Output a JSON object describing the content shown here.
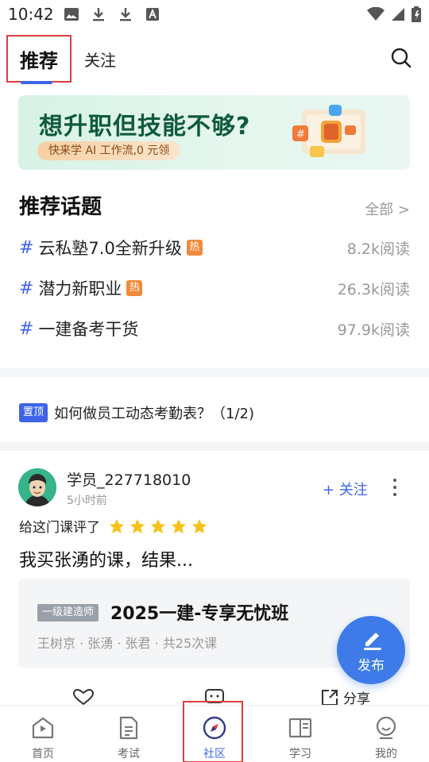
{
  "status_bar": {
    "time": "10:42"
  },
  "top_tabs": {
    "recommend": "推荐",
    "follow": "关注"
  },
  "banner": {
    "title": "想升职但技能不够?",
    "pill": "快来学 AI 工作流,0 元领"
  },
  "topics": {
    "title": "推荐话题",
    "all_link": "全部 >",
    "hot_badge": "热",
    "items": [
      {
        "hash": "#",
        "name": "云私塾7.0全新升级",
        "hot": true,
        "reads": "8.2k阅读"
      },
      {
        "hash": "#",
        "name": "潜力新职业",
        "hot": true,
        "reads": "26.3k阅读"
      },
      {
        "hash": "#",
        "name": "一建备考干货",
        "hot": false,
        "reads": "97.9k阅读"
      }
    ]
  },
  "pinned": {
    "badge": "置顶",
    "text": "如何做员工动态考勤表？（1/2)"
  },
  "post": {
    "username": "学员_227718010",
    "time": "5小时前",
    "follow_label": "+ 关注",
    "rating_label": "给这门课评了",
    "rating": 5,
    "content": "我买张湧的课，结果...",
    "course": {
      "tag": "一级建造师",
      "title": "2025一建-专享无忧班",
      "meta": "王树京 · 张湧 · 张君 · 共25次课"
    },
    "share_label": "分享"
  },
  "fab": {
    "label": "发布"
  },
  "bottom_nav": {
    "items": [
      {
        "label": "首页",
        "icon": "home-icon"
      },
      {
        "label": "考试",
        "icon": "exam-icon"
      },
      {
        "label": "社区",
        "icon": "compass-icon",
        "active": true
      },
      {
        "label": "学习",
        "icon": "book-icon"
      },
      {
        "label": "我的",
        "icon": "profile-icon"
      }
    ]
  },
  "colors": {
    "accent": "#3e64e8",
    "star": "#f7c21b",
    "hot": "#f08a3a",
    "highlight_box": "#e03c3c"
  }
}
